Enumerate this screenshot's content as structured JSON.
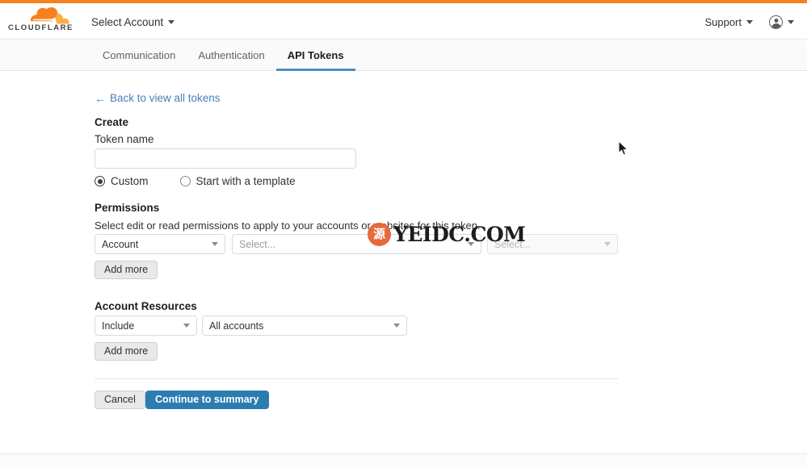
{
  "brand": {
    "name": "CLOUDFLARE",
    "accent_color": "#f6821f",
    "logo_icon": "cloudflare-cloud-icon"
  },
  "header": {
    "account_selector_label": "Select Account",
    "support_label": "Support",
    "account_icon": "user-circle-icon",
    "caret_icon": "chevron-down-icon"
  },
  "tabs": [
    {
      "label": "Communication",
      "active": false
    },
    {
      "label": "Authentication",
      "active": false
    },
    {
      "label": "API Tokens",
      "active": true
    }
  ],
  "main": {
    "back_link": "Back to view all tokens",
    "back_arrow_icon": "arrow-left-icon",
    "create_title": "Create",
    "token_name_label": "Token name",
    "token_name_value": "",
    "token_name_placeholder": "",
    "mode_options": [
      {
        "label": "Custom",
        "selected": true
      },
      {
        "label": "Start with a template",
        "selected": false
      }
    ],
    "permissions": {
      "title": "Permissions",
      "description": "Select edit or read permissions to apply to your accounts or websites for this token.",
      "rows": [
        {
          "group": "Account",
          "resource": "Select...",
          "access": "Select...",
          "access_disabled": true
        }
      ],
      "add_more_label": "Add more"
    },
    "account_resources": {
      "title": "Account Resources",
      "rows": [
        {
          "mode": "Include",
          "scope": "All accounts"
        }
      ],
      "add_more_label": "Add more"
    },
    "actions": {
      "cancel_label": "Cancel",
      "continue_label": "Continue to summary",
      "continue_color": "#2c7cb0"
    }
  },
  "watermark": {
    "badge_glyph": "源",
    "text": "YEIDC.COM",
    "badge_color": "#e8693c"
  }
}
